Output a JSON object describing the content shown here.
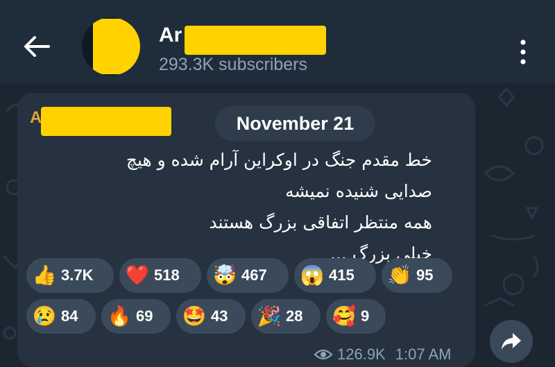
{
  "header": {
    "channel_name": "Ar",
    "subscribers": "293.3K subscribers"
  },
  "message": {
    "sender_initial": "A",
    "date": "November 21",
    "lines": [
      "خط مقدم جنگ در اوکراین آرام شده و هیچ",
      "صدایی شنیده نمیشه",
      "همه منتظر اتفاقی بزرگ هستند",
      "خیلی بزرگ ..."
    ],
    "reactions": [
      {
        "emoji": "👍",
        "count": "3.7K"
      },
      {
        "emoji": "❤️",
        "count": "518"
      },
      {
        "emoji": "🤯",
        "count": "467"
      },
      {
        "emoji": "😱",
        "count": "415"
      },
      {
        "emoji": "👏",
        "count": "95"
      },
      {
        "emoji": "😢",
        "count": "84"
      },
      {
        "emoji": "🔥",
        "count": "69"
      },
      {
        "emoji": "🤩",
        "count": "43"
      },
      {
        "emoji": "🎉",
        "count": "28"
      },
      {
        "emoji": "🥰",
        "count": "9"
      }
    ],
    "views": "126.9K",
    "time": "1:07 AM"
  },
  "icons": {
    "back": "arrow-left-icon",
    "menu": "more-vertical-icon",
    "views": "eye-icon",
    "share": "share-arrow-icon"
  },
  "colors": {
    "header_bg": "#1f2d3b",
    "bubble_bg": "#26323f",
    "reaction_bg": "#3a4a5b",
    "meta_text": "#8ea3b7",
    "sender": "#e0a23a",
    "redaction": "#ffd200"
  }
}
